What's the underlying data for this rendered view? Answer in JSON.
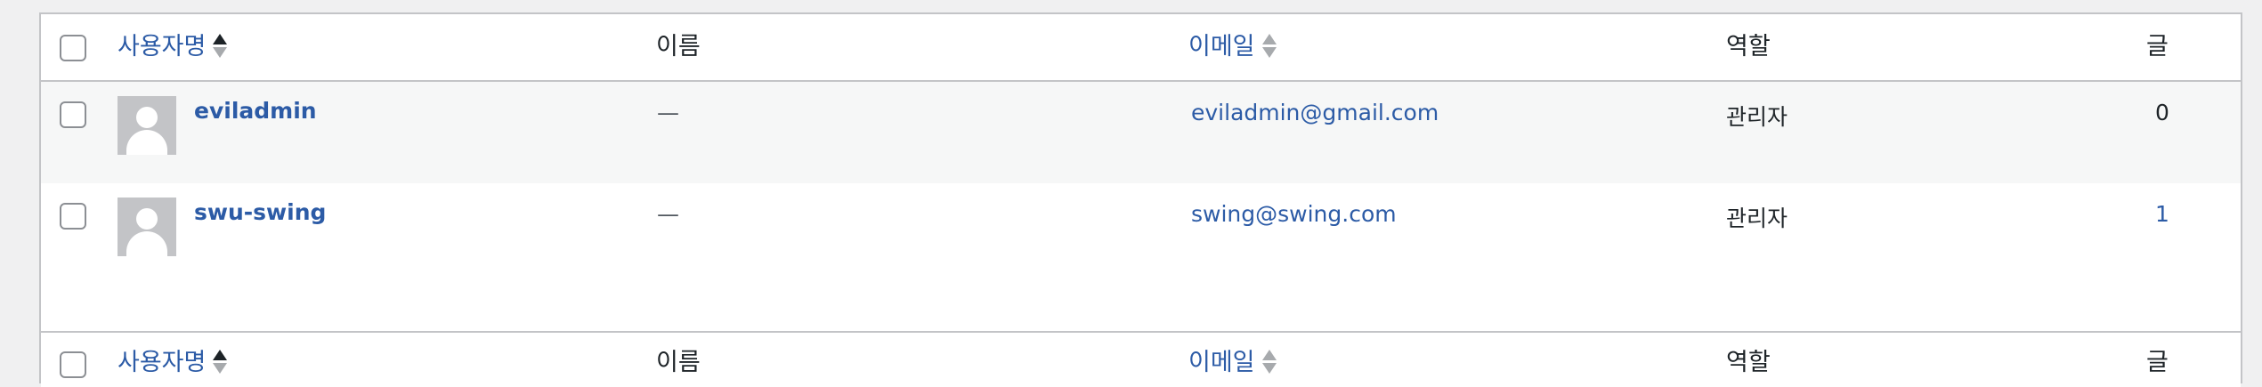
{
  "columns": {
    "username": "사용자명",
    "name": "이름",
    "email": "이메일",
    "role": "역할",
    "posts": "글"
  },
  "users": [
    {
      "username": "eviladmin",
      "name": "—",
      "email": "eviladmin@gmail.com",
      "role": "관리자",
      "posts": "0"
    },
    {
      "username": "swu-swing",
      "name": "—",
      "email": "swing@swing.com",
      "role": "관리자",
      "posts": "1"
    }
  ],
  "colors": {
    "link": "#2c5ba6",
    "row_alt": "#f6f7f7",
    "border": "#c3c4c7"
  }
}
